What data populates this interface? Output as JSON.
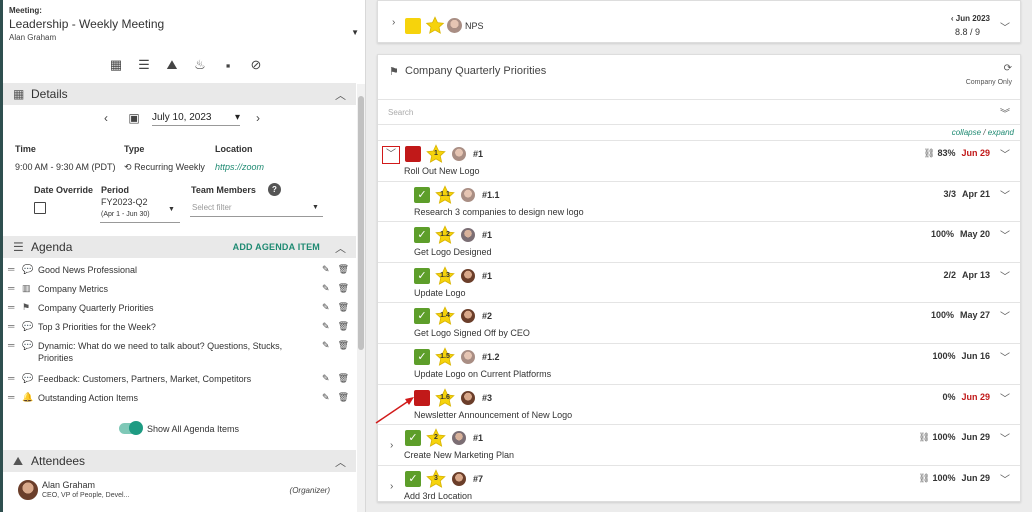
{
  "meeting": {
    "label": "Meeting:",
    "name": "Leadership - Weekly Meeting",
    "owner": "Alan Graham"
  },
  "details": {
    "title": "Details",
    "date": "July 10, 2023",
    "time_label": "Time",
    "time_value": "9:00 AM - 9:30 AM (PDT)",
    "type_label": "Type",
    "type_value": "Recurring Weekly",
    "location_label": "Location",
    "location_value": "https://zoom",
    "date_override_label": "Date Override",
    "period_label": "Period",
    "period_value": "FY2023-Q2",
    "period_range": "(Apr 1 - Jun 30)",
    "team_members_label": "Team Members",
    "team_members_placeholder": "Select filter",
    "help_glyph": "?"
  },
  "agenda": {
    "title": "Agenda",
    "add_label": "ADD AGENDA ITEM",
    "items": [
      {
        "icon": "speech-bubble-icon",
        "label": "Good News Professional"
      },
      {
        "icon": "metrics-icon",
        "label": "Company Metrics"
      },
      {
        "icon": "flag-icon",
        "label": "Company Quarterly Priorities"
      },
      {
        "icon": "speech-bubble-icon",
        "label": "Top 3 Priorities for the Week?"
      },
      {
        "icon": "speech-bubble-icon",
        "label": "Dynamic: What do we need to talk about?  Questions, Stucks, Priorities"
      },
      {
        "icon": "speech-bubble-icon",
        "label": "Feedback:  Customers, Partners, Market, Competitors"
      },
      {
        "icon": "bell-icon",
        "label": "Outstanding Action Items"
      }
    ],
    "toggle_label": "Show All Agenda Items"
  },
  "attendees": {
    "title": "Attendees",
    "list": [
      {
        "name": "Alan Graham",
        "role": "CEO, VP of People, Devel...",
        "tag": "(Organizer)"
      }
    ]
  },
  "nps_card": {
    "label": "NPS",
    "period": "Jun 2023",
    "score": "8.8 / 9"
  },
  "priorities": {
    "title": "Company Quarterly Priorities",
    "scope": "Company Only",
    "search_placeholder": "Search",
    "collapse_label": "collapse",
    "separator": "/",
    "expand_label": "expand",
    "rows": [
      {
        "status": "red",
        "star": "1",
        "avatar": "f",
        "num": "#1",
        "name": "Roll Out New Logo",
        "linked": true,
        "progress": "83%",
        "due": "Jun 29",
        "late": true,
        "level": 0
      },
      {
        "status": "green",
        "star": "1.1",
        "avatar": "f",
        "num": "#1.1",
        "name": "Research 3 companies to design new logo",
        "linked": false,
        "progress": "3/3",
        "due": "Apr 21",
        "late": false,
        "level": 1
      },
      {
        "status": "green",
        "star": "1.2",
        "avatar": "g",
        "num": "#1",
        "name": "Get Logo Designed",
        "linked": false,
        "progress": "100%",
        "due": "May 20",
        "late": false,
        "level": 1
      },
      {
        "status": "green",
        "star": "1.3",
        "avatar": "m",
        "num": "#1",
        "name": "Update Logo",
        "linked": false,
        "progress": "2/2",
        "due": "Apr 13",
        "late": false,
        "level": 1
      },
      {
        "status": "green",
        "star": "1.4",
        "avatar": "m",
        "num": "#2",
        "name": "Get Logo Signed Off by CEO",
        "linked": false,
        "progress": "100%",
        "due": "May 27",
        "late": false,
        "level": 1
      },
      {
        "status": "green",
        "star": "1.5",
        "avatar": "f",
        "num": "#1.2",
        "name": "Update Logo on Current Platforms",
        "linked": false,
        "progress": "100%",
        "due": "Jun 16",
        "late": false,
        "level": 1
      },
      {
        "status": "red",
        "star": "1.6",
        "avatar": "m",
        "num": "#3",
        "name": "Newsletter Announcement of New Logo",
        "linked": false,
        "progress": "0%",
        "due": "Jun 29",
        "late": true,
        "level": 1
      },
      {
        "status": "green",
        "star": "2",
        "avatar": "g",
        "num": "#1",
        "name": "Create New Marketing Plan",
        "linked": true,
        "progress": "100%",
        "due": "Jun 29",
        "late": false,
        "level": 0
      },
      {
        "status": "green",
        "star": "3",
        "avatar": "m",
        "num": "#7",
        "name": "Add 3rd Location",
        "linked": true,
        "progress": "100%",
        "due": "Jun 29",
        "late": false,
        "level": 0
      }
    ]
  },
  "colors": {
    "accent": "#1e8a72",
    "late": "#c11919",
    "done": "#5d9e2a",
    "annotation": "#d11a1a"
  }
}
